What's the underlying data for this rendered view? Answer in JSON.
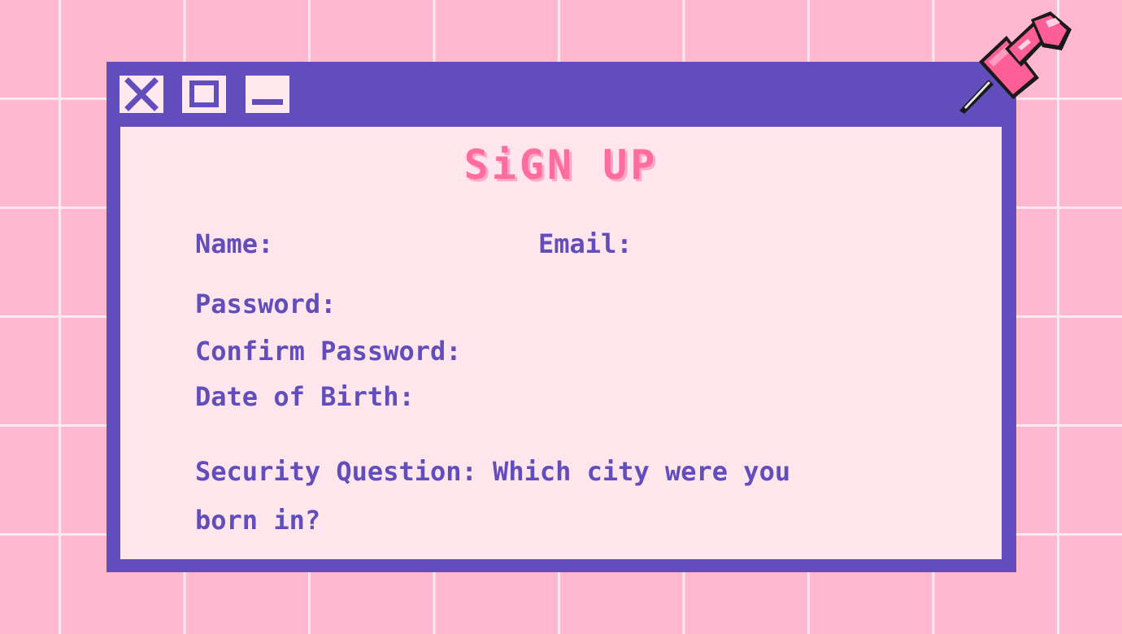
{
  "window": {
    "controls": {
      "close": "close-icon",
      "maximize": "maximize-icon",
      "minimize": "minimize-icon"
    }
  },
  "form": {
    "title": "SiGN UP",
    "fields": {
      "name": "Name:",
      "email": "Email:",
      "password": "Password:",
      "confirm_password": "Confirm Password:",
      "date_of_birth": "Date of Birth:"
    },
    "security_question": "Security Question: Which city were you born in?"
  },
  "decoration": {
    "pin_icon": "pushpin-icon"
  },
  "colors": {
    "background": "#ffb8cf",
    "grid_lines": "#ffe9f0",
    "window_frame": "#614dbc",
    "content_bg": "#ffe6ec",
    "title_pink": "#ff6d9f",
    "label_purple": "#614dbc"
  }
}
